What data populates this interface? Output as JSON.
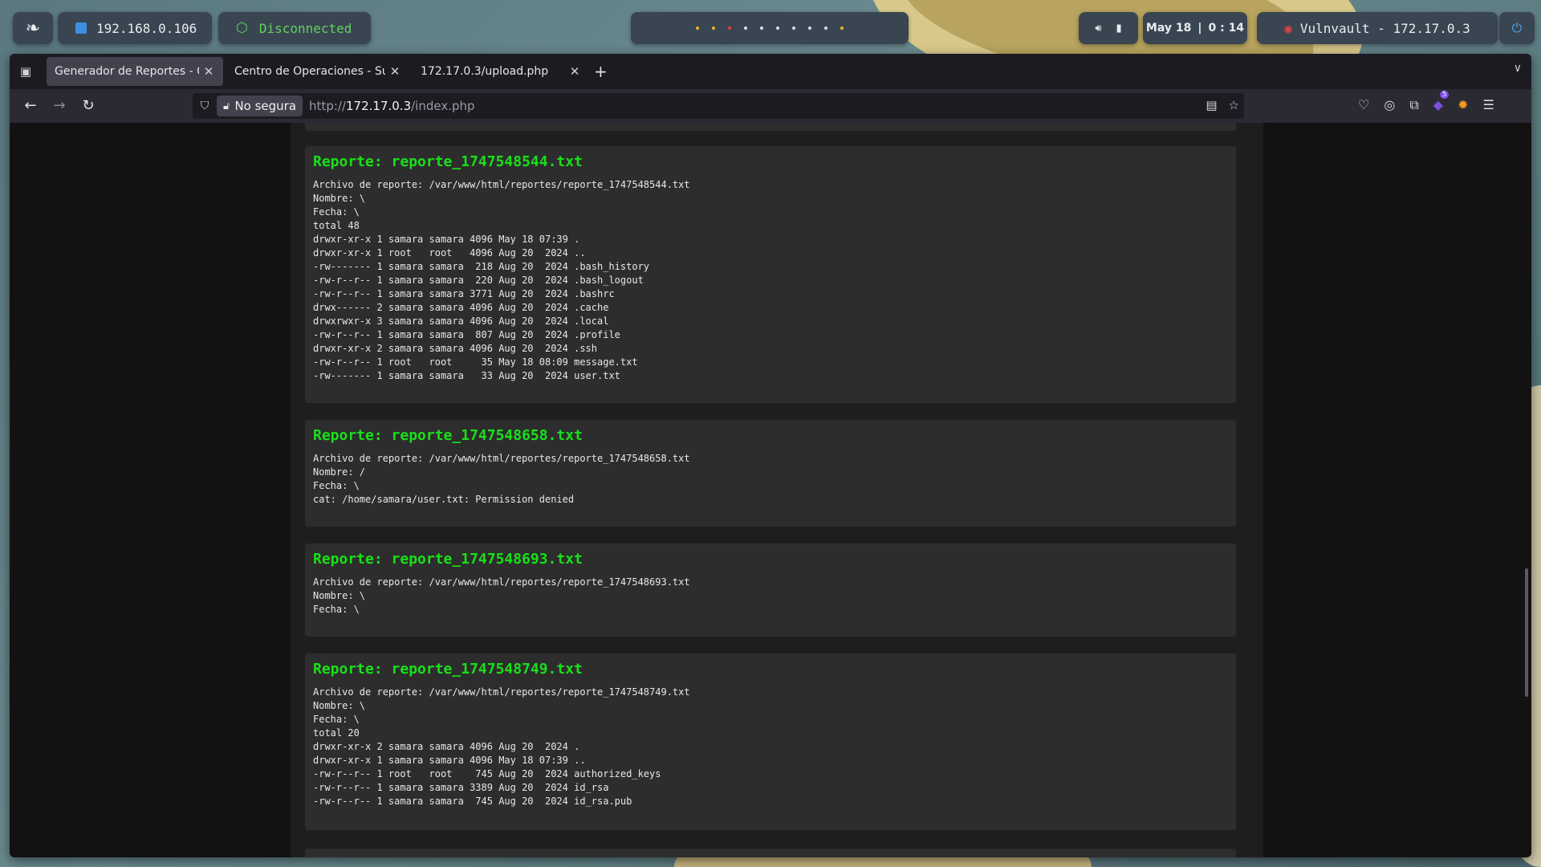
{
  "topbar": {
    "ip": "192.168.0.106",
    "vpn_status": "Disconnected",
    "date": "May 18",
    "separator": "|",
    "time": "0 : 14",
    "target": "Vulnvault - 172.17.0.3"
  },
  "colors": {
    "vpn_green": "#5fd35f",
    "report_title_green": "#18e018",
    "target_red": "#e04444",
    "power_blue": "#4aa3e8"
  },
  "browser": {
    "tabs": [
      {
        "title": "Generador de Reportes - Cei",
        "active": true
      },
      {
        "title": "Centro de Operaciones - Sul",
        "active": false
      },
      {
        "title": "172.17.0.3/upload.php",
        "active": false
      }
    ],
    "address": {
      "security_label": "No segura",
      "url_proto": "http://",
      "url_host": "172.17.0.3",
      "url_path": "/index.php"
    },
    "extension_badge": "5"
  },
  "reports": [
    {
      "title": "Reporte: reporte_1747548544.txt",
      "body": "Archivo de reporte: /var/www/html/reportes/reporte_1747548544.txt\nNombre: \\\nFecha: \\\ntotal 48\ndrwxr-xr-x 1 samara samara 4096 May 18 07:39 .\ndrwxr-xr-x 1 root   root   4096 Aug 20  2024 ..\n-rw------- 1 samara samara  218 Aug 20  2024 .bash_history\n-rw-r--r-- 1 samara samara  220 Aug 20  2024 .bash_logout\n-rw-r--r-- 1 samara samara 3771 Aug 20  2024 .bashrc\ndrwx------ 2 samara samara 4096 Aug 20  2024 .cache\ndrwxrwxr-x 3 samara samara 4096 Aug 20  2024 .local\n-rw-r--r-- 1 samara samara  807 Aug 20  2024 .profile\ndrwxr-xr-x 2 samara samara 4096 Aug 20  2024 .ssh\n-rw-r--r-- 1 root   root     35 May 18 08:09 message.txt\n-rw------- 1 samara samara   33 Aug 20  2024 user.txt"
    },
    {
      "title": "Reporte: reporte_1747548658.txt",
      "body": "Archivo de reporte: /var/www/html/reportes/reporte_1747548658.txt\nNombre: /\nFecha: \\\ncat: /home/samara/user.txt: Permission denied"
    },
    {
      "title": "Reporte: reporte_1747548693.txt",
      "body": "Archivo de reporte: /var/www/html/reportes/reporte_1747548693.txt\nNombre: \\\nFecha: \\"
    },
    {
      "title": "Reporte: reporte_1747548749.txt",
      "body": "Archivo de reporte: /var/www/html/reportes/reporte_1747548749.txt\nNombre: \\\nFecha: \\\ntotal 20\ndrwxr-xr-x 2 samara samara 4096 Aug 20  2024 .\ndrwxr-xr-x 1 samara samara 4096 May 18 07:39 ..\n-rw-r--r-- 1 root   root    745 Aug 20  2024 authorized_keys\n-rw-r--r-- 1 samara samara 3389 Aug 20  2024 id_rsa\n-rw-r--r-- 1 samara samara  745 Aug 20  2024 id_rsa.pub"
    }
  ]
}
